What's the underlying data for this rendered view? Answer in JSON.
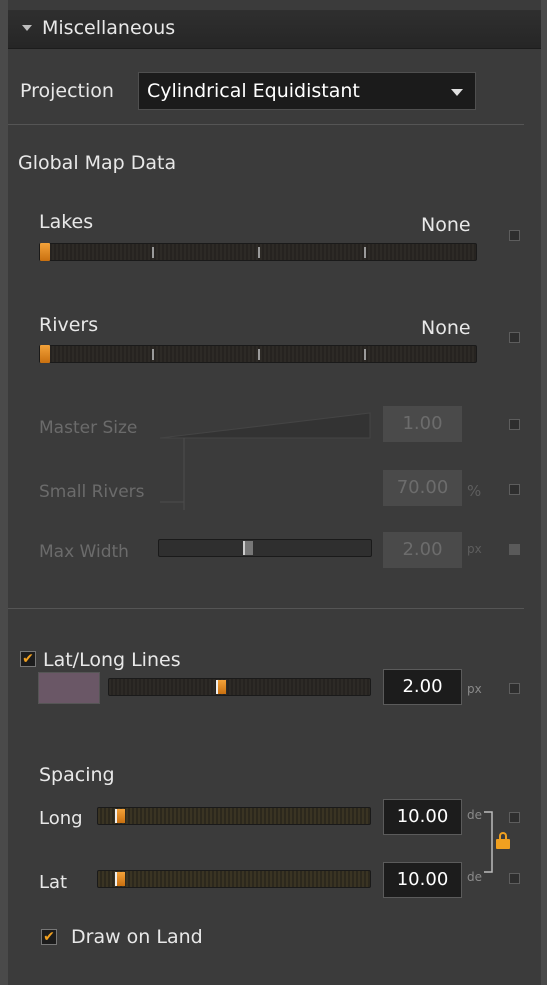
{
  "header": {
    "title": "Miscellaneous"
  },
  "projection": {
    "label": "Projection",
    "value": "Cylindrical Equidistant"
  },
  "global_map_data": {
    "heading": "Global Map Data",
    "lakes": {
      "label": "Lakes",
      "value": "None"
    },
    "rivers": {
      "label": "Rivers",
      "value": "None"
    },
    "master_size": {
      "label": "Master Size",
      "value": "1.00"
    },
    "small_rivers": {
      "label": "Small Rivers",
      "value": "70.00",
      "unit": "%"
    },
    "max_width": {
      "label": "Max Width",
      "value": "2.00",
      "unit": "px"
    }
  },
  "latlong": {
    "label": "Lat/Long Lines",
    "checked": true,
    "line_width": {
      "value": "2.00",
      "unit": "px"
    },
    "swatch_color": "#6a5766",
    "spacing": {
      "heading": "Spacing",
      "long": {
        "label": "Long",
        "value": "10.00",
        "unit": "de"
      },
      "lat": {
        "label": "Lat",
        "value": "10.00",
        "unit": "de"
      }
    },
    "draw_on_land": {
      "label": "Draw on Land",
      "checked": true
    }
  },
  "colors": {
    "accent": "#f0a020",
    "background": "#3b3b3b"
  }
}
